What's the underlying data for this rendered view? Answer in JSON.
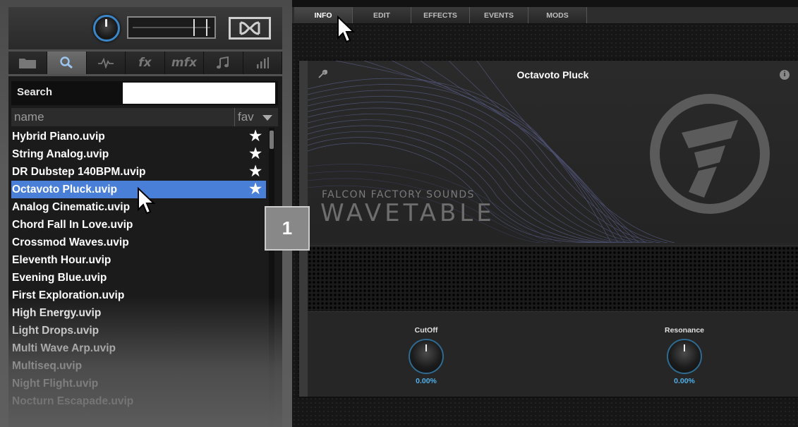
{
  "left_tabs": [
    {
      "icon": "folder-icon",
      "label": ""
    },
    {
      "icon": "search-icon",
      "label": ""
    },
    {
      "icon": "waveform-icon",
      "label": ""
    },
    {
      "icon": "fx-icon",
      "label": "fx"
    },
    {
      "icon": "mfx-icon",
      "label": "mfx"
    },
    {
      "icon": "music-note-icon",
      "label": ""
    },
    {
      "icon": "bars-icon",
      "label": ""
    }
  ],
  "search": {
    "label": "Search",
    "value": ""
  },
  "columns": {
    "name": "name",
    "fav": "fav"
  },
  "presets": [
    {
      "name": "Hybrid Piano.uvip",
      "fav": "★",
      "selected": false
    },
    {
      "name": "String Analog.uvip",
      "fav": "★",
      "selected": false
    },
    {
      "name": "DR Dubstep 140BPM.uvip",
      "fav": "★",
      "selected": false
    },
    {
      "name": "Octavoto Pluck.uvip",
      "fav": "★",
      "selected": true
    },
    {
      "name": "Analog Cinematic.uvip",
      "fav": "",
      "selected": false
    },
    {
      "name": "Chord Fall In Love.uvip",
      "fav": "",
      "selected": false
    },
    {
      "name": "Crossmod Waves.uvip",
      "fav": "",
      "selected": false
    },
    {
      "name": "Eleventh Hour.uvip",
      "fav": "",
      "selected": false
    },
    {
      "name": "Evening Blue.uvip",
      "fav": "",
      "selected": false
    },
    {
      "name": "First Exploration.uvip",
      "fav": "",
      "selected": false
    },
    {
      "name": "High Energy.uvip",
      "fav": "",
      "selected": false
    },
    {
      "name": "Light Drops.uvip",
      "fav": "",
      "selected": false
    },
    {
      "name": "Multi Wave Arp.uvip",
      "fav": "",
      "selected": false
    },
    {
      "name": "Multiseq.uvip",
      "fav": "",
      "selected": false
    },
    {
      "name": "Night Flight.uvip",
      "fav": "",
      "selected": false
    },
    {
      "name": "Nocturn Escapade.uvip",
      "fav": "",
      "selected": false
    }
  ],
  "right_tabs": [
    "INFO",
    "EDIT",
    "EFFECTS",
    "EVENTS",
    "MODS"
  ],
  "active_right_tab": "INFO",
  "device": {
    "title": "Octavoto Pluck",
    "brand_small": "FALCON FACTORY SOUNDS",
    "brand_big": "WAVETABLE",
    "controls": [
      {
        "label": "CutOff",
        "value": "0.00%"
      },
      {
        "label": "Resonance",
        "value": "0.00%"
      }
    ]
  },
  "badge": "1",
  "colors": {
    "selection": "#4a7fd8",
    "knob_ring": "#3a86c8",
    "value_text": "#4fb0e8"
  }
}
